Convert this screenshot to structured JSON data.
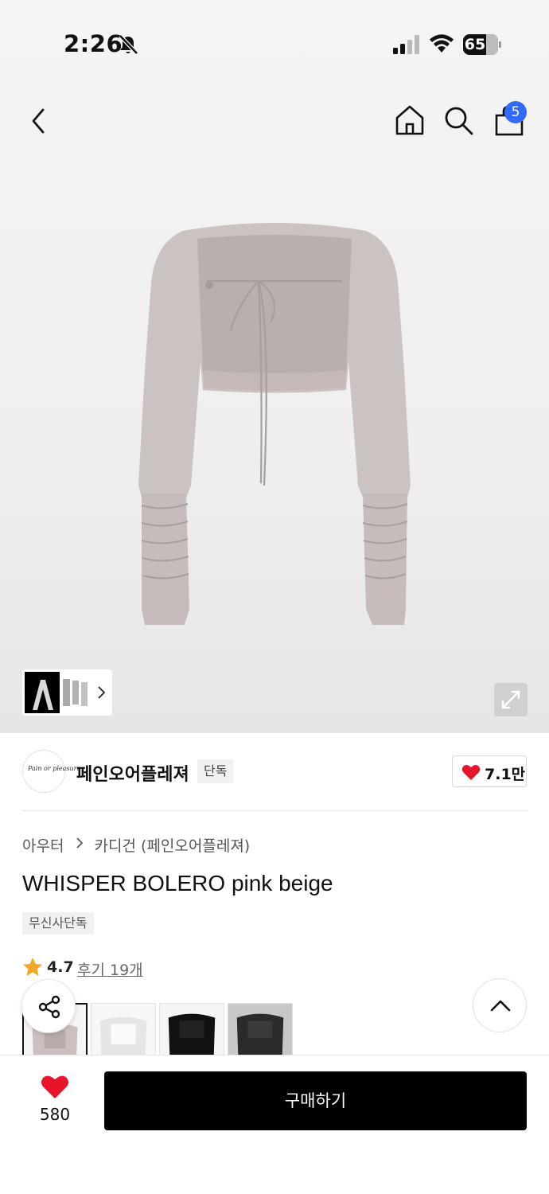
{
  "status_bar": {
    "time": "2:26",
    "battery_percent": 65,
    "battery_text": "65",
    "icons": [
      "bell-muted-icon",
      "cellular-signal-icon",
      "wifi-icon",
      "battery-icon"
    ]
  },
  "nav": {
    "icons": [
      "back-chevron-icon",
      "home-icon",
      "search-icon",
      "shopping-bag-icon"
    ],
    "cart_count": "5"
  },
  "product": {
    "brand_logo_text": "Pain or pleasure",
    "brand_name": "페인오어플레져",
    "brand_tag": "단독",
    "brand_likes": "7.1만",
    "breadcrumb": [
      "아우터",
      "카디건 (페인오어플레져)"
    ],
    "title": "WHISPER BOLERO pink beige",
    "exclusive_tag": "무신사단독",
    "rating": "4.7",
    "review_link": "후기 19개",
    "color_options": [
      "pink beige",
      "white",
      "black",
      "charcoal"
    ]
  },
  "colors": {
    "accent_badge": "#2f6bff",
    "heart": "#e8142a",
    "star": "#f5a623",
    "buy_button": "#000000",
    "garment": "#c9bfbf"
  },
  "bottom_bar": {
    "wish_count": "580",
    "buy_label": "구매하기"
  }
}
